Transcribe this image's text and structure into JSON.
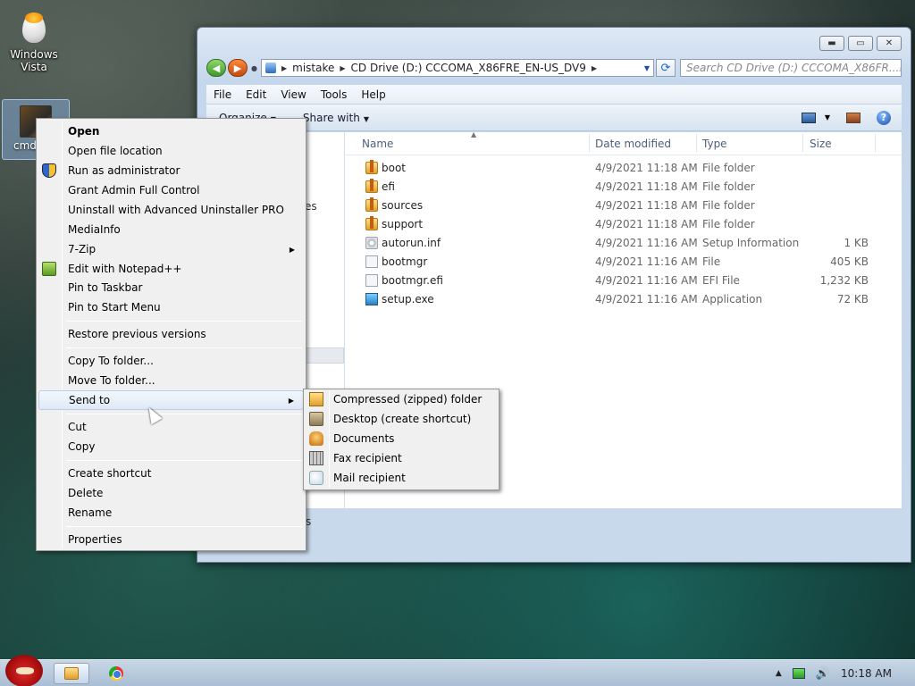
{
  "desktop": {
    "icons": [
      {
        "label_line1": "Windows",
        "label_line2": "Vista",
        "icon": "egg-icon"
      },
      {
        "label": "cmd",
        "icon": "cmd-icon"
      }
    ]
  },
  "explorer": {
    "address": {
      "segments": [
        "mistake",
        "CD Drive (D:) CCCOMA_X86FRE_EN-US_DV9"
      ]
    },
    "search_placeholder": "Search CD Drive (D:) CCCOMA_X86FR...",
    "menubar": [
      "File",
      "Edit",
      "View",
      "Tools",
      "Help"
    ],
    "commandbar": {
      "organize": "Organize",
      "share_with": "Share with"
    },
    "nav_fragment": "es",
    "status_fragment": "s",
    "columns": [
      "Name",
      "Date modified",
      "Type",
      "Size"
    ],
    "files": [
      {
        "name": "boot",
        "date": "4/9/2021 11:18 AM",
        "type": "File folder",
        "size": "",
        "icon": "folder-icon"
      },
      {
        "name": "efi",
        "date": "4/9/2021 11:18 AM",
        "type": "File folder",
        "size": "",
        "icon": "folder-icon"
      },
      {
        "name": "sources",
        "date": "4/9/2021 11:18 AM",
        "type": "File folder",
        "size": "",
        "icon": "folder-icon"
      },
      {
        "name": "support",
        "date": "4/9/2021 11:18 AM",
        "type": "File folder",
        "size": "",
        "icon": "folder-icon"
      },
      {
        "name": "autorun.inf",
        "date": "4/9/2021 11:16 AM",
        "type": "Setup Information",
        "size": "1 KB",
        "icon": "settings-file-icon"
      },
      {
        "name": "bootmgr",
        "date": "4/9/2021 11:16 AM",
        "type": "File",
        "size": "405 KB",
        "icon": "file-icon"
      },
      {
        "name": "bootmgr.efi",
        "date": "4/9/2021 11:16 AM",
        "type": "EFI File",
        "size": "1,232 KB",
        "icon": "file-icon"
      },
      {
        "name": "setup.exe",
        "date": "4/9/2021 11:16 AM",
        "type": "Application",
        "size": "72 KB",
        "icon": "setup-icon"
      }
    ]
  },
  "context_menu": {
    "items": [
      {
        "label": "Open"
      },
      {
        "label": "Open file location"
      },
      {
        "label": "Run as administrator",
        "icon": "shield-icon"
      },
      {
        "label": "Grant Admin Full Control"
      },
      {
        "label": "Uninstall with Advanced Uninstaller PRO"
      },
      {
        "label": "MediaInfo"
      },
      {
        "label": "7-Zip"
      },
      {
        "label": "Edit with Notepad++",
        "icon": "notepad-plus-plus-icon"
      },
      {
        "label": "Pin to Taskbar"
      },
      {
        "label": "Pin to Start Menu"
      },
      {
        "label": "Restore previous versions"
      },
      {
        "label": "Copy To folder..."
      },
      {
        "label": "Move To folder..."
      },
      {
        "label": "Send to"
      },
      {
        "label": "Cut"
      },
      {
        "label": "Copy"
      },
      {
        "label": "Create shortcut"
      },
      {
        "label": "Delete"
      },
      {
        "label": "Rename"
      },
      {
        "label": "Properties"
      }
    ]
  },
  "send_to_menu": {
    "items": [
      {
        "label": "Compressed (zipped) folder",
        "icon": "zip-folder-icon"
      },
      {
        "label": "Desktop (create shortcut)",
        "icon": "desktop-icon"
      },
      {
        "label": "Documents",
        "icon": "documents-icon"
      },
      {
        "label": "Fax recipient",
        "icon": "fax-icon"
      },
      {
        "label": "Mail recipient",
        "icon": "mail-icon"
      }
    ]
  },
  "taskbar": {
    "clock": "10:18 AM"
  }
}
